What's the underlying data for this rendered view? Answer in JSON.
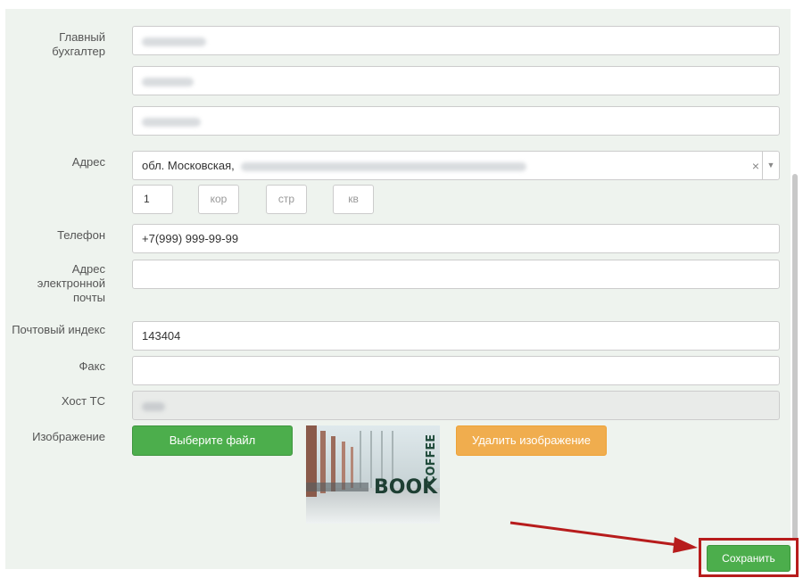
{
  "form": {
    "chief_accountant": {
      "label": "Главный бухгалтер",
      "lastname_hidden": "",
      "firstname_hidden": "",
      "patronymic_hidden": ""
    },
    "address": {
      "label": "Адрес",
      "value_prefix": "обл. Московская,",
      "clear_icon": "×",
      "arrow_icon": "▼",
      "house": "1",
      "building_placeholder": "кор",
      "structure_placeholder": "стр",
      "apartment_placeholder": "кв"
    },
    "phone": {
      "label": "Телефон",
      "value": "+7(999) 999-99-99"
    },
    "email": {
      "label": "Адрес электронной почты",
      "value": ""
    },
    "postal": {
      "label": "Почтовый индекс",
      "value": "143404"
    },
    "fax": {
      "label": "Факс",
      "value": ""
    },
    "host": {
      "label": "Хост ТС"
    },
    "image": {
      "label": "Изображение",
      "choose_file_label": "Выберите файл",
      "delete_image_label": "Удалить изображение",
      "preview_text": "BOOK",
      "preview_sign": "COFFEE"
    }
  },
  "actions": {
    "save_label": "Сохранить"
  },
  "colors": {
    "panel": "#eef3ee",
    "green": "#4cae4c",
    "orange": "#f0ad4e",
    "highlight": "#b71c1c"
  }
}
